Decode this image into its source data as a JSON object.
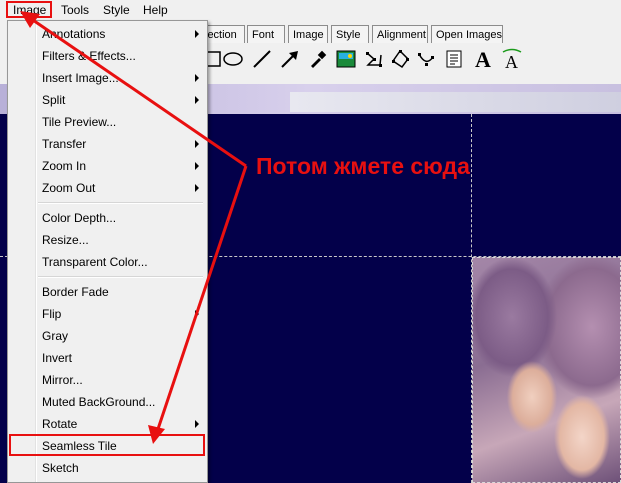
{
  "menubar": {
    "items": [
      {
        "label": "Image"
      },
      {
        "label": "Tools"
      },
      {
        "label": "Style"
      },
      {
        "label": "Help"
      }
    ]
  },
  "toolbar": {
    "tabs": [
      {
        "label": "lection"
      },
      {
        "label": "Font"
      },
      {
        "label": "Image"
      },
      {
        "label": "Style"
      },
      {
        "label": "Alignment"
      },
      {
        "label": "Open Images"
      }
    ],
    "tools": [
      {
        "icon": "rectangle-tool-icon"
      },
      {
        "icon": "ellipse-tool-icon"
      },
      {
        "icon": "line-tool-icon"
      },
      {
        "icon": "arrow-tool-icon"
      },
      {
        "icon": "eyedropper-icon"
      },
      {
        "icon": "image-insert-icon"
      },
      {
        "icon": "polygon-tool-icon"
      },
      {
        "icon": "polygon-tool-icon"
      },
      {
        "icon": "node-tool-icon"
      },
      {
        "icon": "text-frame-icon"
      },
      {
        "icon": "text-tool-icon"
      },
      {
        "icon": "text-path-icon"
      }
    ]
  },
  "dropdown": {
    "items": [
      {
        "label": "Annotations",
        "submenu": true
      },
      {
        "label": "Filters & Effects...",
        "submenu": false
      },
      {
        "label": "Insert Image...",
        "submenu": true
      },
      {
        "label": "Split",
        "submenu": true
      },
      {
        "label": "Tile Preview...",
        "submenu": false
      },
      {
        "label": "Transfer",
        "submenu": true
      },
      {
        "label": "Zoom In",
        "submenu": true
      },
      {
        "label": "Zoom Out",
        "submenu": true
      },
      {
        "label": "Color Depth...",
        "submenu": false
      },
      {
        "label": "Resize...",
        "submenu": false
      },
      {
        "label": "Transparent Color...",
        "submenu": false
      },
      {
        "label": "Border Fade",
        "submenu": false
      },
      {
        "label": "Flip",
        "submenu": true
      },
      {
        "label": "Gray",
        "submenu": false
      },
      {
        "label": "Invert",
        "submenu": false
      },
      {
        "label": "Mirror...",
        "submenu": false
      },
      {
        "label": "Muted BackGround...",
        "submenu": false
      },
      {
        "label": "Rotate",
        "submenu": true
      },
      {
        "label": "Seamless Tile",
        "submenu": false
      },
      {
        "label": "Sketch",
        "submenu": false
      }
    ]
  },
  "annotation": {
    "text": "Потом жмете сюда",
    "color": "#e81010"
  },
  "colors": {
    "canvas": "#03004a",
    "highlight": "#e81010",
    "menu_bg": "#f0f0f0"
  }
}
